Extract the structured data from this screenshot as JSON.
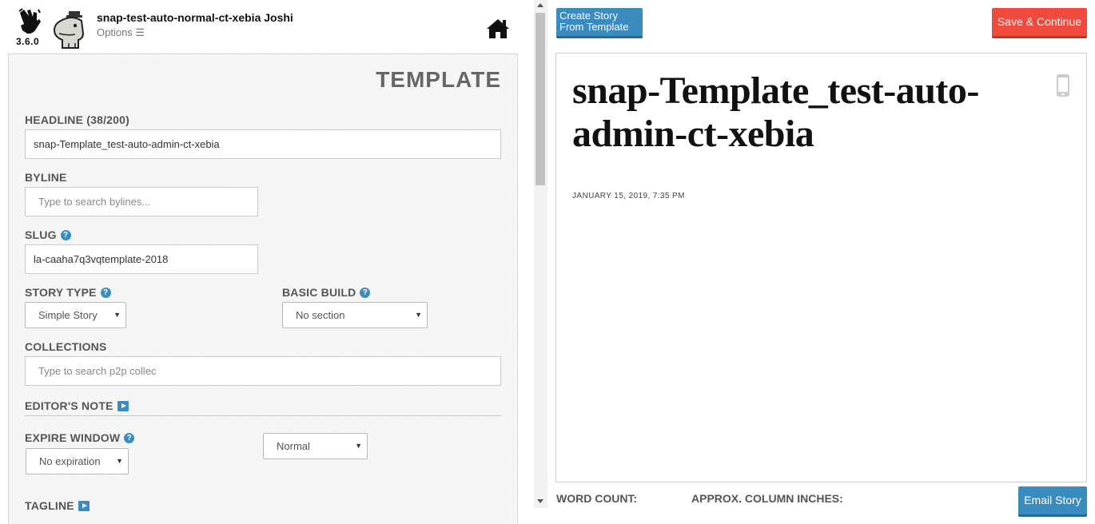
{
  "header": {
    "version": "3.6.0",
    "user_title": "snap-test-auto-normal-ct-xebia Joshi",
    "options_label": "Options ☰",
    "icons": [
      "snap-hand-logo",
      "dino-avatar",
      "home-icon"
    ]
  },
  "form": {
    "title": "TEMPLATE",
    "headline_label": "HEADLINE (38/200)",
    "headline_value": "snap-Template_test-auto-admin-ct-xebia",
    "byline_label": "BYLINE",
    "byline_placeholder": "Type to search bylines...",
    "slug_label": "SLUG",
    "slug_value": "la-caaha7q3vqtemplate-2018",
    "story_type_label": "STORY TYPE",
    "story_type_value": "Simple Story",
    "basic_build_label": "BASIC BUILD",
    "basic_build_value": "No section",
    "collections_label": "COLLECTIONS",
    "collections_placeholder": "Type to search p2p collec",
    "editors_note_label": "EDITOR'S NOTE",
    "expire_window_label": "EXPIRE WINDOW",
    "expire_value": "No expiration",
    "priority_value": "Normal",
    "tagline_label": "TAGLINE"
  },
  "preview": {
    "create_button": "Create Story From Template",
    "save_button": "Save & Continue",
    "headline": "snap-Template_test-auto-admin-ct-xebia",
    "date": "JANUARY 15, 2019, 7:35 PM",
    "word_count_label": "WORD COUNT:",
    "column_inches_label": "APPROX. COLUMN INCHES:",
    "email_button": "Email Story"
  },
  "colors": {
    "accent_blue": "#3a8bbf",
    "save_red": "#f04a3e"
  }
}
